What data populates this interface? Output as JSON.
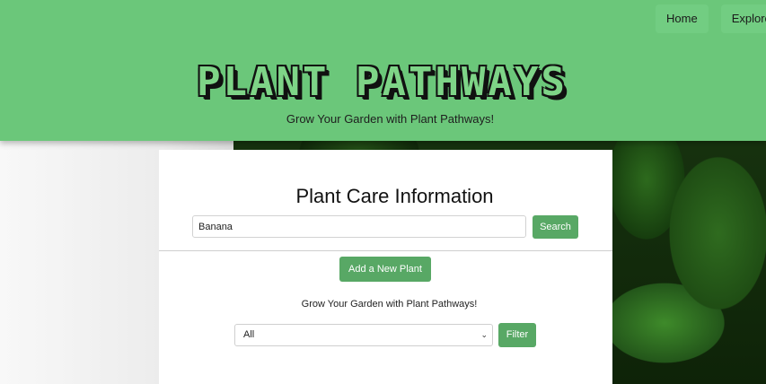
{
  "nav": {
    "items": [
      {
        "label": "Home"
      },
      {
        "label": "Explore"
      }
    ]
  },
  "header": {
    "title": "PLANT PATHWAYS",
    "subtitle": "Grow Your Garden with Plant Pathways!"
  },
  "card": {
    "title": "Plant Care Information",
    "search": {
      "value": "Banana",
      "button_label": "Search"
    },
    "add_button_label": "Add a New Plant",
    "tagline": "Grow Your Garden with Plant Pathways!",
    "filter": {
      "selected": "All",
      "button_label": "Filter"
    }
  },
  "colors": {
    "header_bg": "#6bc77a",
    "button_bg": "#58a865",
    "nav_bg": "#72cd82"
  }
}
